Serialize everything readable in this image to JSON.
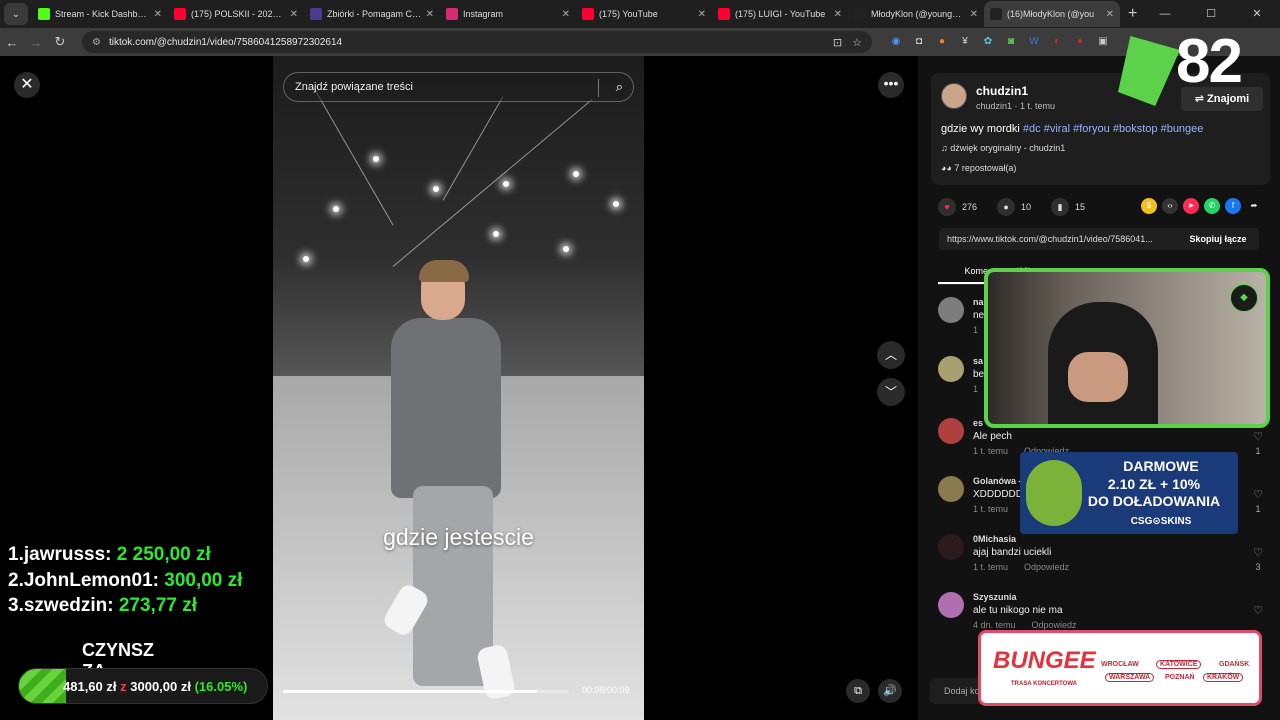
{
  "browser": {
    "tabs": [
      {
        "title": "Stream - Kick Dashboard",
        "color": "#53fc18",
        "active": false
      },
      {
        "title": "(175) POLSKII - 2026 (MU",
        "color": "#ff0033",
        "active": false
      },
      {
        "title": "Zbiórki - Pomagam Cance",
        "color": "#4d3a8f",
        "active": false
      },
      {
        "title": "Instagram",
        "color": "#d62976",
        "active": false
      },
      {
        "title": "(175) YouTube",
        "color": "#ff0033",
        "active": false
      },
      {
        "title": "(175) LUIGI - YouTube",
        "color": "#ff0033",
        "active": false
      },
      {
        "title": "MłodyKlon (@youngklon",
        "color": "#222222",
        "active": false
      },
      {
        "title": "(16)MłodyKlon (@you",
        "color": "#222222",
        "active": true
      }
    ],
    "url": "tiktok.com/@chudzin1/video/7586041258972302614"
  },
  "video": {
    "search_placeholder": "Znajdź powiązane treści",
    "caption": "gdzie jestescie",
    "time": "00:08/00:09",
    "progress": 0.889
  },
  "post": {
    "username": "chudzin1",
    "subline": "chudzin1 · 1 t. temu",
    "friends_label": "⇌ Znajomi",
    "desc_text": "gdzie wy mordki",
    "tags": [
      "#dc",
      "#viral",
      "#foryou",
      "#bokstop",
      "#bungee"
    ],
    "sound": "♫  dźwięk oryginalny - chudzin1",
    "reposts": "7 repostował(a)",
    "likes": "276",
    "comments_count": "10",
    "saves": "15",
    "link": "https://www.tiktok.com/@chudzin1/video/7586041...",
    "copy_label": "Skopiuj łącze",
    "comments_tab": "Komentarze (10)",
    "add_comment": "Dodaj ko"
  },
  "comments": [
    {
      "name": "na",
      "text": "ne",
      "meta": "1",
      "reply": "",
      "likes": "",
      "avatar": "#7d7d7d"
    },
    {
      "name": "sa",
      "text": "be",
      "meta": "1",
      "reply": "",
      "likes": "",
      "avatar": "#a8a070"
    },
    {
      "name": "es",
      "text": "Ale pech",
      "meta": "1 t. temu",
      "reply": "Odpowiedz",
      "likes": "1",
      "avatar": "#b04040"
    },
    {
      "name": "Golanówa -",
      "text": "XDDDDDDI",
      "meta": "1 t. temu",
      "reply": "",
      "likes": "1",
      "avatar": "#8a7a50"
    },
    {
      "name": "0Michasia",
      "text": "ajaj bandzi ucie​kli",
      "meta": "1 t. temu",
      "reply": "Odpowiedz",
      "likes": "3",
      "avatar": "#2c1b1b"
    },
    {
      "name": "Szyszunia",
      "text": "ale tu nikogo nie ma",
      "meta": "4 dn. temu",
      "reply": "Odpowiedz",
      "likes": "",
      "avatar": "#b070b0"
    }
  ],
  "overlay": {
    "leaderboard": [
      {
        "rank_name": "1.jawrusss:",
        "amount": "2 250,00 zł"
      },
      {
        "rank_name": "2.JohnLemon01:",
        "amount": "300,00 zł"
      },
      {
        "rank_name": "3.szwedzin:",
        "amount": "273,77 zł"
      }
    ],
    "goal_title": "CZYNSZ ZA CHATE",
    "goal_current": "481,60 zł",
    "goal_sep": "z",
    "goal_target": "3000,00 zł",
    "goal_pct": "(16.05%)",
    "goal_fraction": 0.1605,
    "counter": "82",
    "csg_line1": "DARMOWE",
    "csg_line2": "2.10 ZŁ + 10%",
    "csg_line3": "DO DOŁADOWANIA",
    "csg_brand": "CSG⊙SKINS",
    "bungee_title": "BUNGEE",
    "bungee_sub": "TRASA KONCERTOWA",
    "bungee_cities": [
      "WROCŁAW",
      "KATOWICE",
      "GDAŃSK",
      "WARSZAWA",
      "POZNAŃ",
      "KRAKÓW"
    ],
    "webcam_logo": "◆"
  }
}
